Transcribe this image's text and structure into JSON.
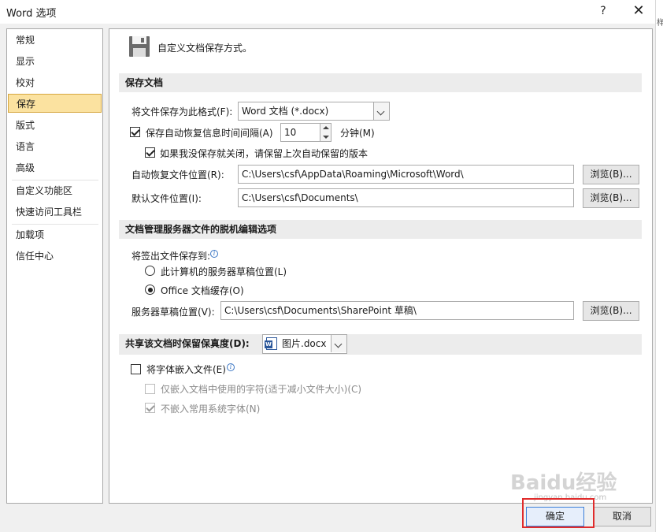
{
  "window": {
    "title": "Word 选项",
    "help": "?",
    "close": "✕",
    "edge_glyph": "样"
  },
  "sidebar": {
    "items": [
      {
        "label": "常规"
      },
      {
        "label": "显示"
      },
      {
        "label": "校对"
      },
      {
        "label": "保存",
        "active": true
      },
      {
        "label": "版式"
      },
      {
        "label": "语言"
      },
      {
        "label": "高级"
      },
      {
        "label": "自定义功能区"
      },
      {
        "label": "快速访问工具栏"
      },
      {
        "label": "加载项"
      },
      {
        "label": "信任中心"
      }
    ]
  },
  "header": {
    "text": "自定义文档保存方式。",
    "icon": "floppy-disk-icon"
  },
  "save_docs": {
    "section_title": "保存文档",
    "format_label": "将文件保存为此格式(F):",
    "format_value": "Word 文档 (*.docx)",
    "autorecover_label": "保存自动恢复信息时间间隔(A)",
    "autorecover_checked": true,
    "interval_value": "10",
    "minutes_label": "分钟(M)",
    "keep_last_label": "如果我没保存就关闭，请保留上次自动保留的版本",
    "keep_last_checked": true,
    "autorecover_location_label": "自动恢复文件位置(R):",
    "autorecover_location_value": "C:\\Users\\csf\\AppData\\Roaming\\Microsoft\\Word\\",
    "default_location_label": "默认文件位置(I):",
    "default_location_value": "C:\\Users\\csf\\Documents\\",
    "browse_label": "浏览(B)..."
  },
  "offline": {
    "section_title": "文档管理服务器文件的脱机编辑选项",
    "checkout_label": "将签出文件保存到:",
    "option_server": "此计算机的服务器草稿位置(L)",
    "option_cache": "Office 文档缓存(O)",
    "selected": "cache",
    "drafts_label": "服务器草稿位置(V):",
    "drafts_value": "C:\\Users\\csf\\Documents\\SharePoint 草稿\\",
    "browse_label": "浏览(B)..."
  },
  "fidelity": {
    "section_title": "共享该文档时保留保真度(D):",
    "doc_value": "图片.docx",
    "embed_fonts_label": "将字体嵌入文件(E)",
    "embed_fonts_checked": false,
    "embed_used_only_label": "仅嵌入文档中使用的字符(适于减小文件大小)(C)",
    "embed_used_only_checked": false,
    "no_common_label": "不嵌入常用系统字体(N)",
    "no_common_checked": true
  },
  "footer": {
    "ok_label": "确定",
    "cancel_label": "取消"
  },
  "watermark": {
    "text": "Baidu经验",
    "sub": "jingyan.baidu.com"
  }
}
